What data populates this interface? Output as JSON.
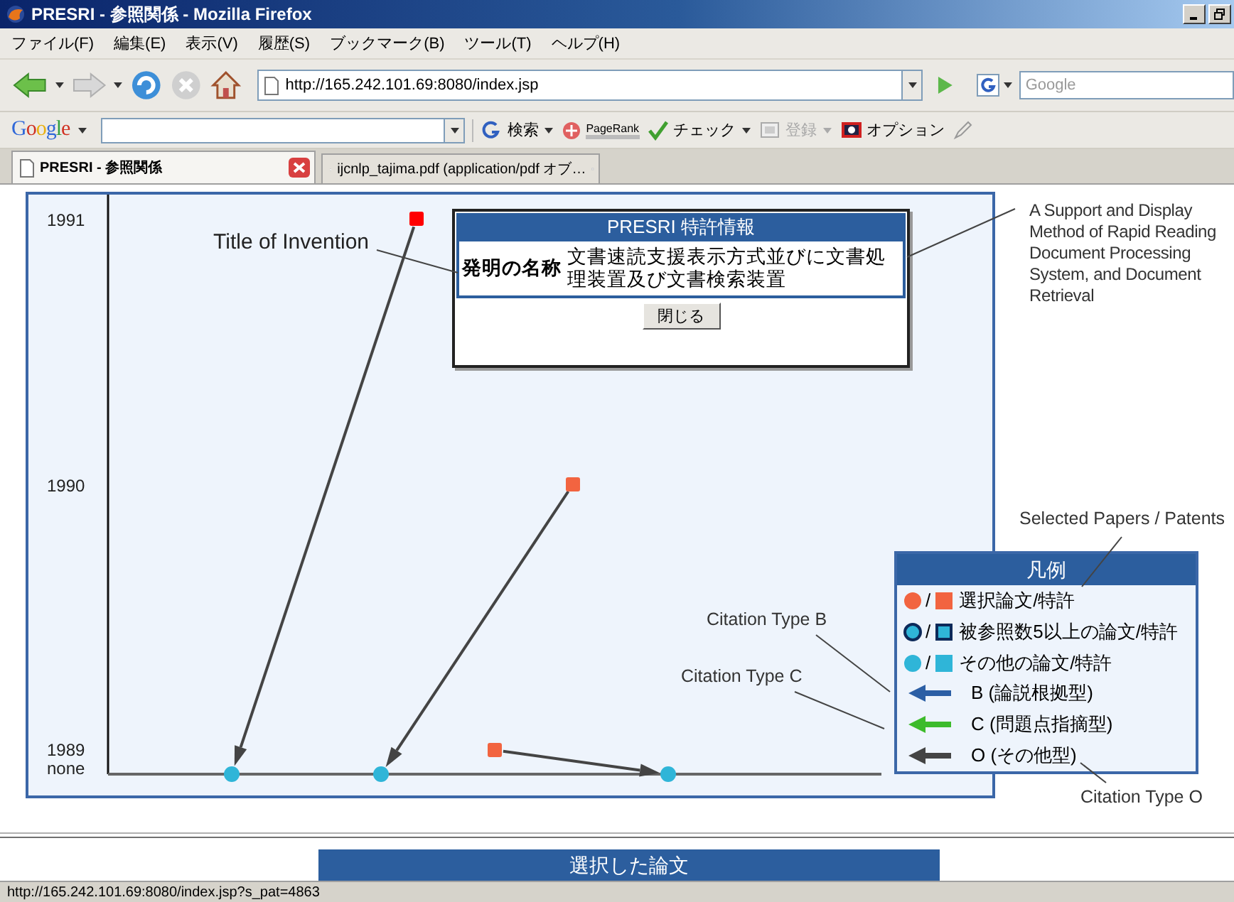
{
  "window": {
    "title": "PRESRI - 参照関係 - Mozilla Firefox"
  },
  "menu": [
    "ファイル(F)",
    "編集(E)",
    "表示(V)",
    "履歴(S)",
    "ブックマーク(B)",
    "ツール(T)",
    "ヘルプ(H)"
  ],
  "address_bar": {
    "value": "http://165.242.101.69:8080/index.jsp"
  },
  "search_field": {
    "placeholder": "Google"
  },
  "google_toolbar": {
    "logo": "Google",
    "buttons": [
      {
        "kind": "search",
        "label": "検索",
        "disabled": false
      },
      {
        "kind": "pagerank",
        "label": "PageRank",
        "disabled": false
      },
      {
        "kind": "check",
        "label": "チェック",
        "disabled": false
      },
      {
        "kind": "register",
        "label": "登録",
        "disabled": true
      },
      {
        "kind": "options",
        "label": "オプション",
        "disabled": false
      }
    ]
  },
  "tabs": [
    {
      "label": "PRESRI - 参照関係",
      "selected": true
    },
    {
      "label": "ijcnlp_tajima.pdf (application/pdf オブ…",
      "selected": false
    }
  ],
  "diagram": {
    "years": [
      "1991",
      "1990",
      "1989",
      "none"
    ],
    "nodes": [
      {
        "kind": "square",
        "color": "#ff0000"
      },
      {
        "kind": "square",
        "color": "#f26440"
      },
      {
        "kind": "square",
        "color": "#f26440"
      },
      {
        "kind": "circle",
        "color": "#2fb5d8"
      },
      {
        "kind": "circle",
        "color": "#2fb5d8"
      },
      {
        "kind": "circle",
        "color": "#2fb5d8"
      }
    ],
    "edges": [
      {
        "kind": "other"
      },
      {
        "kind": "other"
      },
      {
        "kind": "other"
      }
    ]
  },
  "popup": {
    "title": "PRESRI 特許情報",
    "field_label": "発明の名称",
    "field_value": "文書速読支援表示方式並びに文書処理装置及び文書検索装置",
    "button": "閉じる"
  },
  "legend": {
    "title": "凡例",
    "items": [
      {
        "kind": "node",
        "color": "#f26440",
        "outlined": false,
        "separator": "/",
        "label": "選択論文/特許"
      },
      {
        "kind": "node",
        "color": "#2fb5d8",
        "outlined": true,
        "separator": "/",
        "label": "被参照数5以上の論文/特許"
      },
      {
        "kind": "node",
        "color": "#2fb5d8",
        "outlined": false,
        "separator": "/",
        "label": "その他の論文/特許"
      },
      {
        "kind": "arrow",
        "color": "#2c5fa5",
        "label": "B (論説根拠型)"
      },
      {
        "kind": "arrow",
        "color": "#3dbb2b",
        "label": "C (問題点指摘型)"
      },
      {
        "kind": "arrow",
        "color": "#444444",
        "label": "O (その他型)"
      }
    ]
  },
  "annotations": [
    "Title of Invention",
    "A Support and Display Method of Rapid Reading Document Processing System, and Document Retrieval",
    "Selected Papers / Patents",
    "Citation Type B",
    "Citation Type C",
    "Citation Type O"
  ],
  "bottom_panel": {
    "title": "選択した論文"
  },
  "status_bar": {
    "text": "http://165.242.101.69:8080/index.jsp?s_pat=4863"
  }
}
